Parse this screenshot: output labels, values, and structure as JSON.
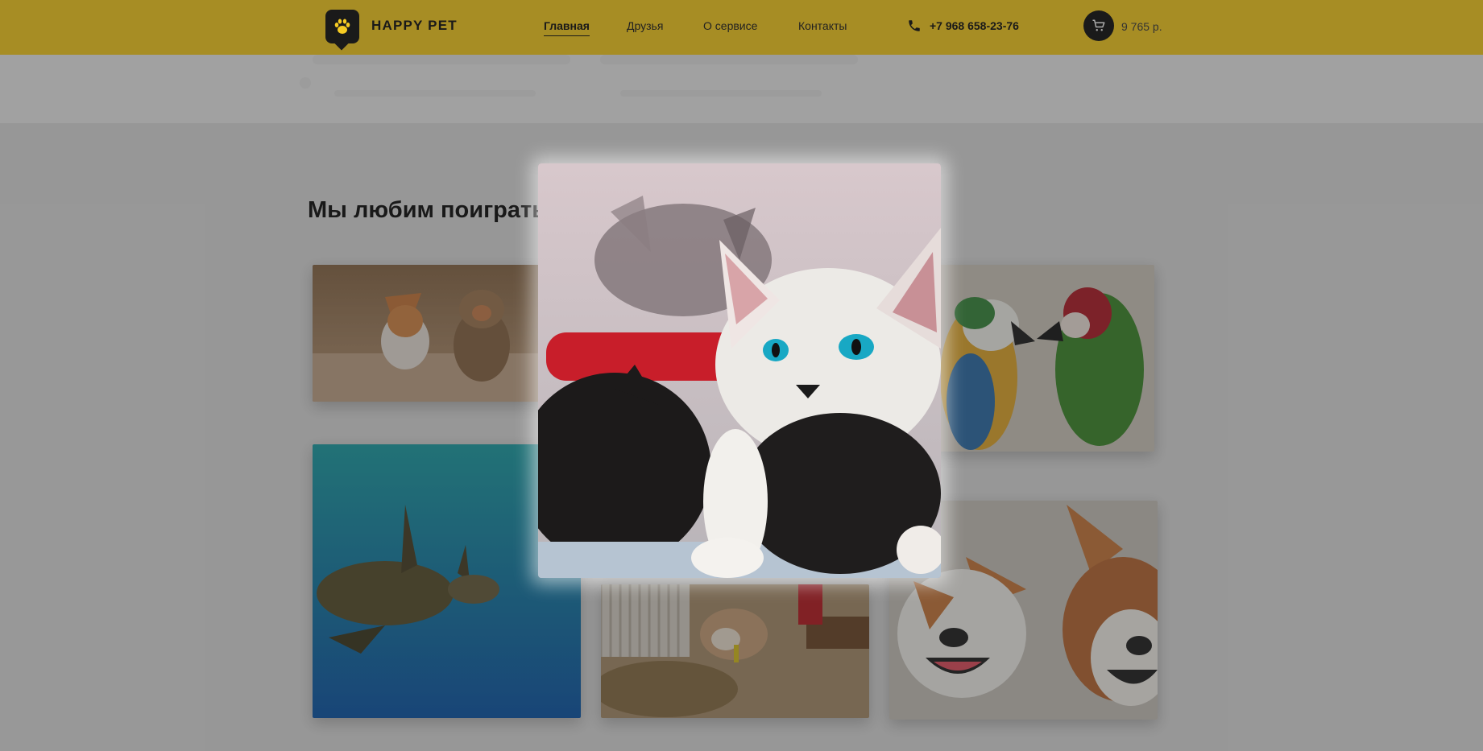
{
  "header": {
    "logo_text": "HAPPY PET",
    "nav": [
      {
        "label": "Главная",
        "active": true
      },
      {
        "label": "Друзья",
        "active": false
      },
      {
        "label": "О сервисе",
        "active": false
      },
      {
        "label": "Контакты",
        "active": false
      }
    ],
    "phone": "+7 968 658-23-76",
    "cart_total": "9 765 р."
  },
  "section": {
    "title": "Мы любим поиграть"
  },
  "gallery": [
    {
      "name": "dogs-running-photo",
      "subject": "corgi and yorkshire terrier running"
    },
    {
      "name": "kittens-photo",
      "subject": "white kitten with blue eyes and black kitten"
    },
    {
      "name": "parrots-photo",
      "subject": "blue-yellow macaw and green macaw"
    },
    {
      "name": "sea-turtle-photo",
      "subject": "sea turtle swimming"
    },
    {
      "name": "hamster-photo",
      "subject": "hamster in cage"
    },
    {
      "name": "dogs-smiling-photo",
      "subject": "two smiling corgis"
    }
  ],
  "modal": {
    "open": true,
    "image": "kittens-photo"
  },
  "colors": {
    "header_bg": "#f6cb23",
    "logo_bg": "#121212",
    "overlay": "rgba(40,40,40,0.38)"
  },
  "icons": [
    "paw-icon",
    "phone-icon",
    "cart-icon"
  ]
}
